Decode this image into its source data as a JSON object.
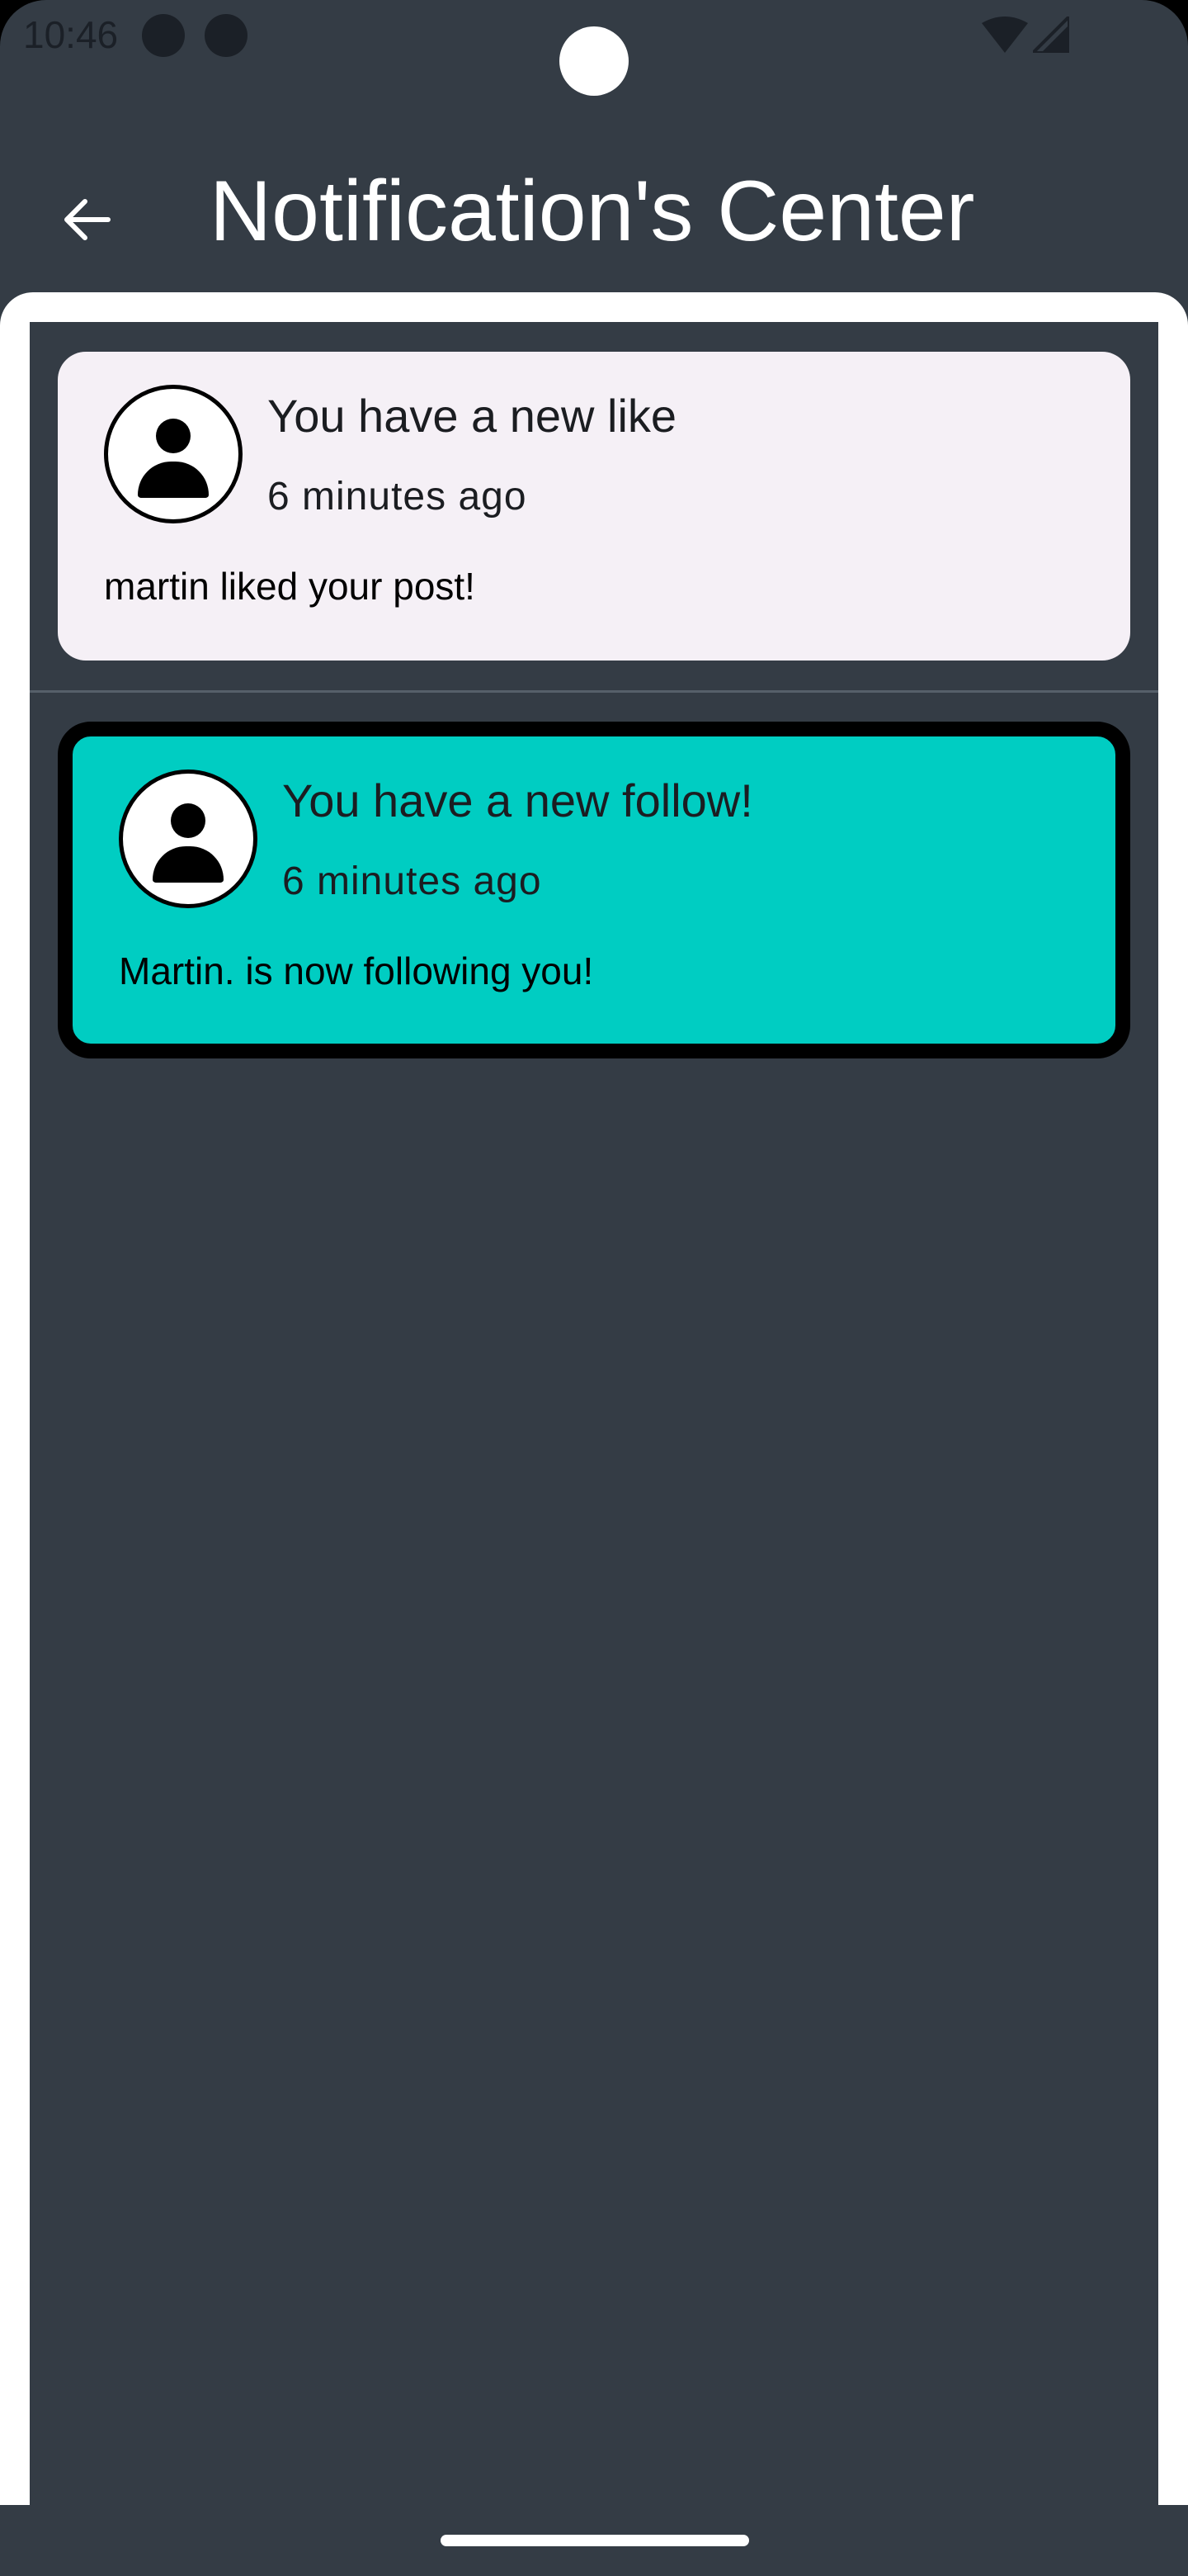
{
  "status_bar": {
    "time": "10:46",
    "icons": [
      "notification-dot-icon",
      "notification-dot-icon",
      "wifi-icon",
      "signal-icon"
    ]
  },
  "app_bar": {
    "back_icon": "arrow-left-icon",
    "title": "Notification's Center"
  },
  "notifications": [
    {
      "title": "You have a new like",
      "time": "6 minutes ago",
      "body": "martin liked your post!",
      "avatar_icon": "person-icon",
      "background": "#f5f0f6",
      "highlighted": false
    },
    {
      "title": "You have a new follow!",
      "time": "6 minutes ago",
      "body": "Martin. is now following you!",
      "avatar_icon": "person-icon",
      "background": "#00cdc2",
      "highlighted": true
    }
  ],
  "colors": {
    "background": "#343c45",
    "accent": "#00cdc2"
  }
}
